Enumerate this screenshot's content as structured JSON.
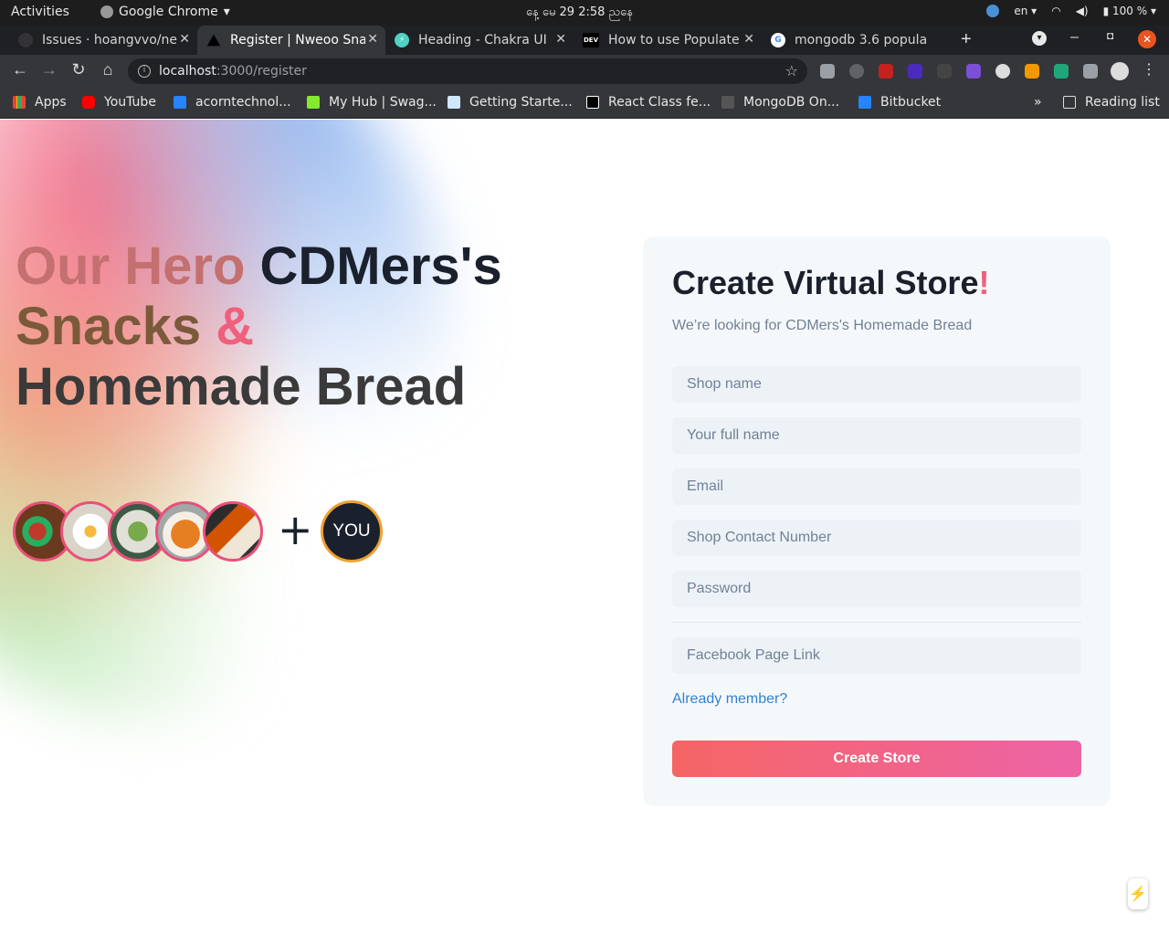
{
  "os_bar": {
    "activities": "Activities",
    "app_name": "Google Chrome",
    "clock": "နေ့ မေ 29   2:58 ညနေ",
    "lang": "en",
    "battery": "100 %"
  },
  "tabs": [
    {
      "label": "Issues · hoangvvo/ne",
      "icon": "github-icon"
    },
    {
      "label": "Register | Nweoo Sna",
      "icon": "nextjs-icon"
    },
    {
      "label": "Heading - Chakra UI",
      "icon": "chakra-icon"
    },
    {
      "label": "How to use Populate",
      "icon": "dev-icon"
    },
    {
      "label": "mongodb 3.6 popula",
      "icon": "google-icon"
    }
  ],
  "address_bar": {
    "host": "localhost",
    "path": ":3000/register"
  },
  "bookmarks": [
    {
      "label": "Apps"
    },
    {
      "label": "YouTube"
    },
    {
      "label": "acorntechnol..."
    },
    {
      "label": "My Hub | Swag..."
    },
    {
      "label": "Getting Starte..."
    },
    {
      "label": "React Class fe..."
    },
    {
      "label": "MongoDB On..."
    },
    {
      "label": "Bitbucket"
    }
  ],
  "bookmarks_more": "»",
  "reading_list": "Reading list",
  "hero": {
    "line1a": "Our Hero ",
    "line1b": "CDMers's",
    "line2a": "Snacks ",
    "line2b": "&",
    "line3": "Homemade Bread"
  },
  "avatars": {
    "plus": "+",
    "you": "YOU"
  },
  "form": {
    "title": "Create Virtual Store",
    "title_mark": "!",
    "subtitle": "We’re looking for CDMers's Homemade Bread",
    "shop_name_placeholder": "Shop name",
    "full_name_placeholder": "Your full name",
    "email_placeholder": "Email",
    "contact_placeholder": "Shop Contact Number",
    "password_placeholder": "Password",
    "facebook_placeholder": "Facebook Page Link",
    "already_member": "Already member?",
    "submit": "Create Store"
  },
  "colors": {
    "accent_pink": "#f0607d",
    "link_blue": "#3182ce",
    "button_from": "#f56565",
    "button_to": "#ed64a6",
    "dark": "#1a202c"
  }
}
